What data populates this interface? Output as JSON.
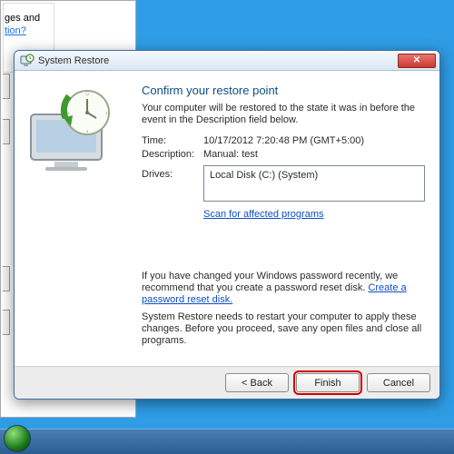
{
  "bg": {
    "snip_line1": "ges and",
    "snip_link": "tion?"
  },
  "dialog": {
    "title": "System Restore",
    "heading": "Confirm your restore point",
    "intro": "Your computer will be restored to the state it was in before the event in the Description field below.",
    "time_label": "Time:",
    "time_value": "10/17/2012 7:20:48 PM (GMT+5:00)",
    "desc_label": "Description:",
    "desc_value": "Manual: test",
    "drives_label": "Drives:",
    "drives_value": "Local Disk (C:) (System)",
    "scan_link": "Scan for affected programs",
    "pw_text": "If you have changed your Windows password recently, we recommend that you create a password reset disk. ",
    "pw_link": "Create a password reset disk.",
    "restart_text": "System Restore needs to restart your computer to apply these changes. Before you proceed, save any open files and close all programs.",
    "buttons": {
      "back": "< Back",
      "finish": "Finish",
      "cancel": "Cancel"
    }
  }
}
